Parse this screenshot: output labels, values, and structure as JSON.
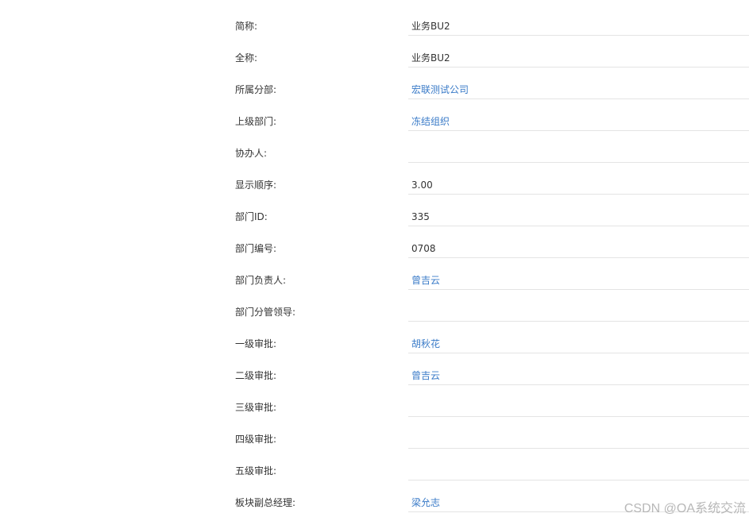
{
  "fields": [
    {
      "label": "简称:",
      "value": "业务BU2",
      "link": false
    },
    {
      "label": "全称:",
      "value": "业务BU2",
      "link": false
    },
    {
      "label": "所属分部:",
      "value": "宏联测试公司",
      "link": true
    },
    {
      "label": "上级部门:",
      "value": "冻结组织",
      "link": true
    },
    {
      "label": "协办人:",
      "value": "",
      "link": false
    },
    {
      "label": "显示顺序:",
      "value": "3.00",
      "link": false
    },
    {
      "label": "部门ID:",
      "value": "335",
      "link": false
    },
    {
      "label": "部门编号:",
      "value": "0708",
      "link": false
    },
    {
      "label": "部门负责人:",
      "value": "曾吉云",
      "link": true
    },
    {
      "label": "部门分管领导:",
      "value": "",
      "link": false
    },
    {
      "label": "一级审批:",
      "value": "胡秋花",
      "link": true
    },
    {
      "label": "二级审批:",
      "value": "曾吉云",
      "link": true
    },
    {
      "label": "三级审批:",
      "value": "",
      "link": false
    },
    {
      "label": "四级审批:",
      "value": "",
      "link": false
    },
    {
      "label": "五级审批:",
      "value": "",
      "link": false
    },
    {
      "label": "板块副总经理:",
      "value": "梁允志",
      "link": true
    }
  ],
  "watermark": "CSDN @OA系统交流",
  "colors": {
    "link": "#3a7bc8",
    "text": "#333333",
    "divider": "#e4e4e4"
  }
}
